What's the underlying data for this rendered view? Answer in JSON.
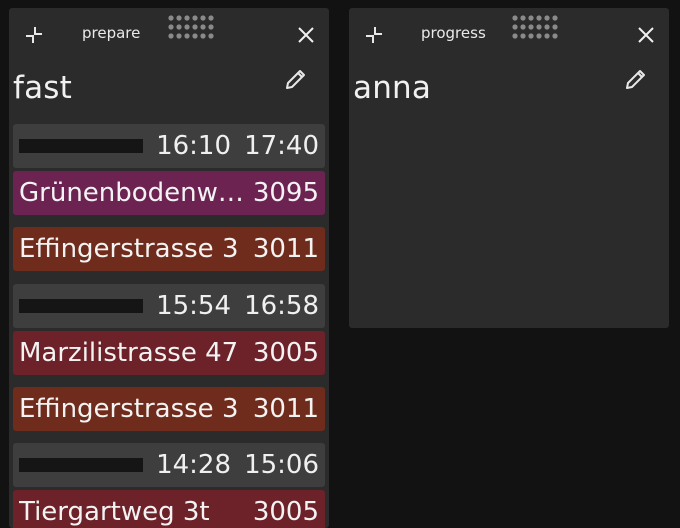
{
  "panels": [
    {
      "name": "prepare",
      "title": "fast",
      "trips": [
        {
          "start": "16:10",
          "end": "17:40",
          "stops": [
            {
              "name": "Grünenbodenw…",
              "zip": "3095",
              "color": "#6d2352"
            },
            {
              "name": "Effingerstrasse 3",
              "zip": "3011",
              "color": "#6f2b1b"
            }
          ]
        },
        {
          "start": "15:54",
          "end": "16:58",
          "stops": [
            {
              "name": "Marzilistrasse 47",
              "zip": "3005",
              "color": "#6d2129"
            },
            {
              "name": "Effingerstrasse 3",
              "zip": "3011",
              "color": "#6f2b1b"
            }
          ]
        },
        {
          "start": "14:28",
          "end": "15:06",
          "stops": [
            {
              "name": "Tiergartweg 3t",
              "zip": "3005",
              "color": "#6d2129"
            }
          ]
        }
      ]
    },
    {
      "name": "progress",
      "title": "anna",
      "trips": []
    }
  ],
  "icons": {
    "collapse": "collapse-icon",
    "drag": "drag-handle-icon",
    "close": "close-icon",
    "edit": "pencil-icon"
  },
  "colors": {
    "background": "#121212",
    "panel": "#2b2b2b",
    "trip_header": "#3e3e3e"
  }
}
